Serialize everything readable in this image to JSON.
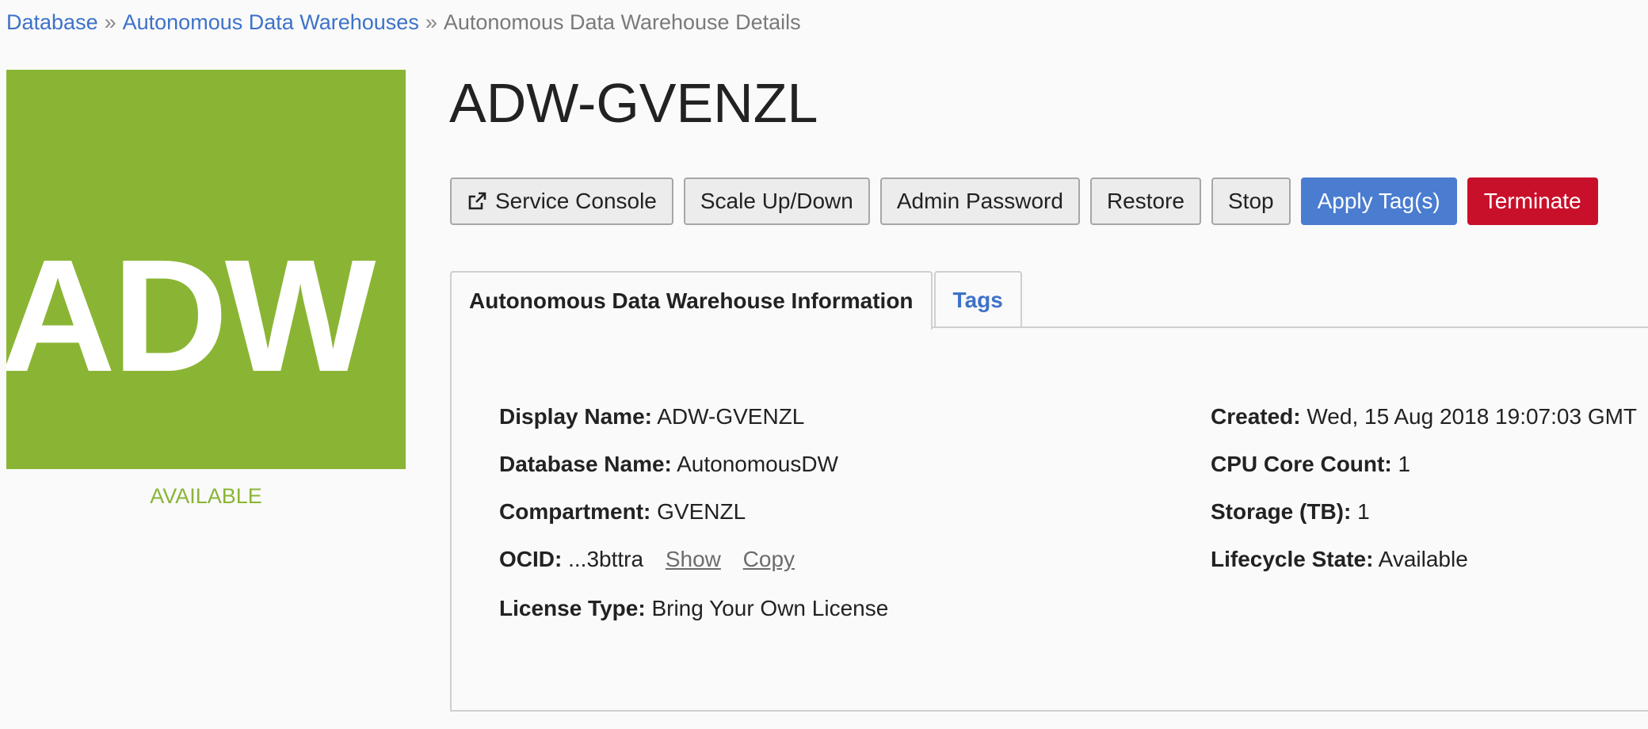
{
  "breadcrumb": {
    "items": [
      "Database",
      "Autonomous Data Warehouses"
    ],
    "separator": "»",
    "current": "Autonomous Data Warehouse Details"
  },
  "badge": {
    "text": "ADW",
    "color": "#8ab534",
    "status": "AVAILABLE",
    "status_color": "#8ab534"
  },
  "title": "ADW-GVENZL",
  "actions": {
    "service_console": "Service Console",
    "service_console_icon": "external-link-icon",
    "scale": "Scale Up/Down",
    "admin_password": "Admin Password",
    "restore": "Restore",
    "stop": "Stop",
    "apply_tags": "Apply Tag(s)",
    "terminate": "Terminate",
    "primary_color": "#4a7cd0",
    "danger_color": "#c9102a"
  },
  "tabs": {
    "info": "Autonomous Data Warehouse Information",
    "tags": "Tags"
  },
  "details": {
    "display_name": {
      "label": "Display Name:",
      "value": "ADW-GVENZL"
    },
    "database_name": {
      "label": "Database Name:",
      "value": "AutonomousDW"
    },
    "compartment": {
      "label": "Compartment:",
      "value": "GVENZL"
    },
    "ocid": {
      "label": "OCID:",
      "value": "...3bttra",
      "show": "Show",
      "copy": "Copy"
    },
    "license_type": {
      "label": "License Type:",
      "value": "Bring Your Own License"
    },
    "created": {
      "label": "Created:",
      "value": "Wed, 15 Aug 2018 19:07:03 GMT"
    },
    "cpu_core_count": {
      "label": "CPU Core Count:",
      "value": "1"
    },
    "storage": {
      "label": "Storage (TB):",
      "value": "1"
    },
    "lifecycle_state": {
      "label": "Lifecycle State:",
      "value": "Available"
    }
  }
}
